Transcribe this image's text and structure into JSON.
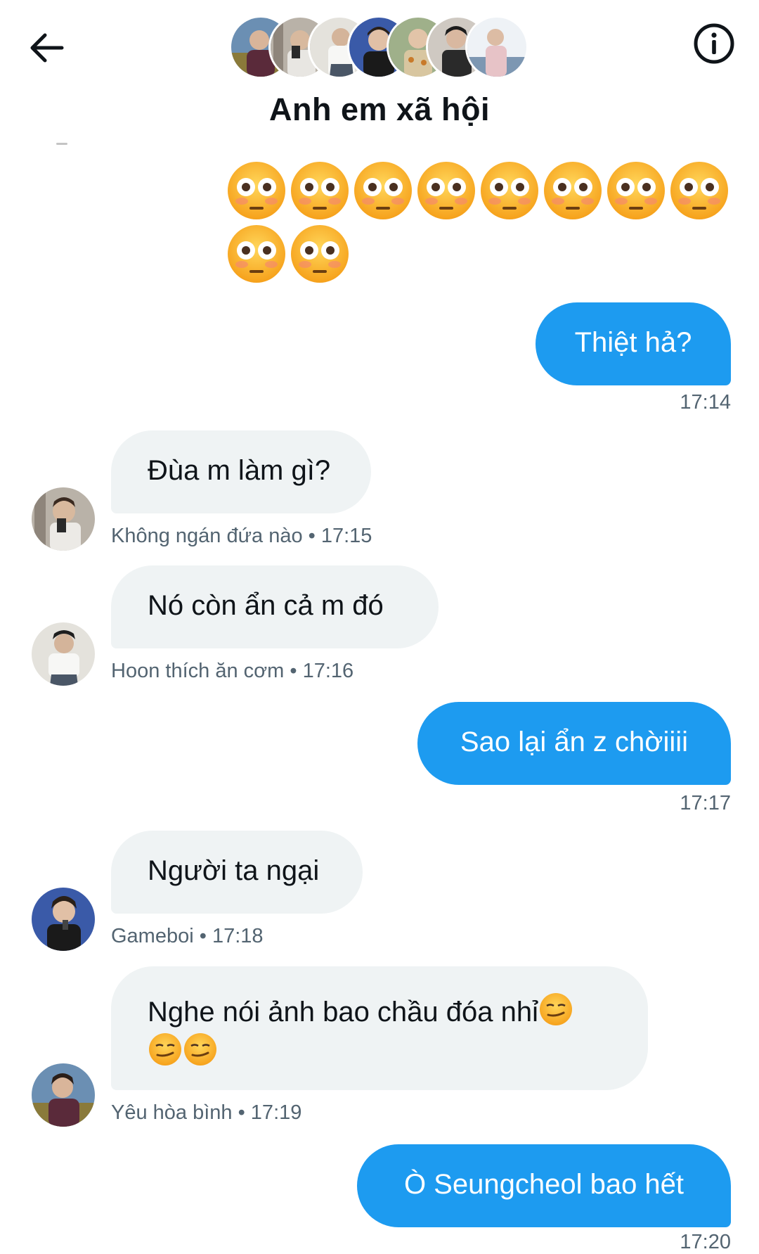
{
  "header": {
    "title": "Anh em xã hội",
    "back_icon": "arrow-left-icon",
    "info_icon": "info-icon",
    "member_avatar_count": 7
  },
  "emoji_reaction": {
    "emoji": "flushed-face",
    "count": 10
  },
  "messages": [
    {
      "direction": "out",
      "text": "Thiệt hả?",
      "time": "17:14"
    },
    {
      "direction": "in",
      "text": "Đùa m làm gì?",
      "sender": "Không ngán đứa nào",
      "time": "17:15"
    },
    {
      "direction": "in",
      "text": "Nó còn ẩn cả m đó",
      "sender": "Hoon thích ăn cơm",
      "time": "17:16"
    },
    {
      "direction": "out",
      "text": "Sao lại ẩn z chờiiii",
      "time": "17:17"
    },
    {
      "direction": "in",
      "text": "Người ta ngại",
      "sender": "Gameboi",
      "time": "17:18"
    },
    {
      "direction": "in",
      "text": "Nghe nói ảnh bao chầu đóa nhỉ",
      "trailing_emoji": "smirking-face",
      "trailing_emoji_count": 3,
      "sender": "Yêu hòa bình",
      "time": "17:19"
    },
    {
      "direction": "out",
      "text": "Ò Seungcheol bao hết",
      "time": "17:20"
    }
  ],
  "meta_lines": {
    "m1": "17:14",
    "m2": "Không ngán đứa nào • 17:15",
    "m3": "Hoon thích ăn cơm • 17:16",
    "m4": "17:17",
    "m5": "Gameboi • 17:18",
    "m6": "Yêu hòa bình • 17:19",
    "m7": "17:20"
  },
  "colors": {
    "outgoing_bubble": "#1d9bf0",
    "incoming_bubble": "#eff3f4",
    "meta_text": "#536471",
    "title_text": "#0f1419"
  }
}
